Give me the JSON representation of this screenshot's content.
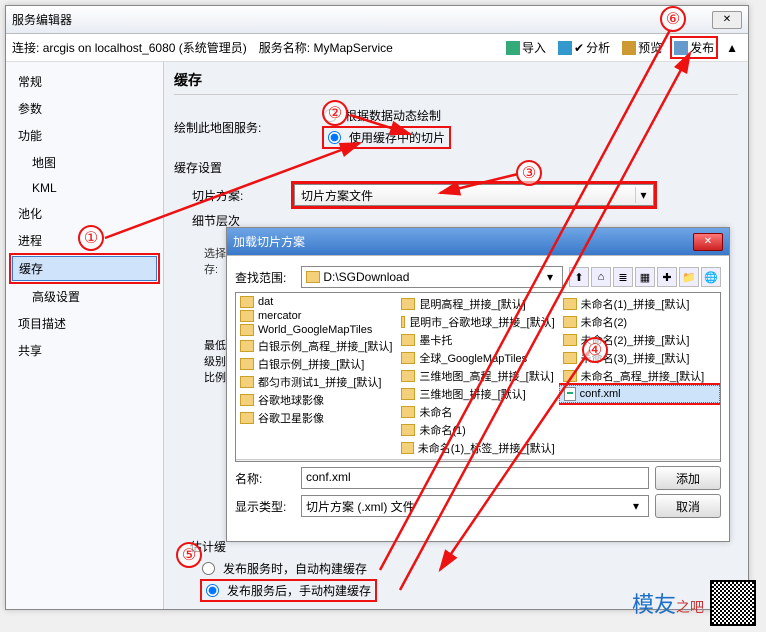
{
  "window": {
    "title": "服务编辑器",
    "close_glyph": "✕"
  },
  "conn": {
    "label": "连接:",
    "value": "arcgis on localhost_6080 (系统管理员)",
    "svc_label": "服务名称:",
    "svc_value": "MyMapService"
  },
  "toolbar": {
    "import": "导入",
    "analyze": "分析",
    "preview": "预览",
    "publish": "发布"
  },
  "sidebar": {
    "items": [
      "常规",
      "参数",
      "功能"
    ],
    "sub_items": [
      "地图",
      "KML"
    ],
    "items2": [
      "池化",
      "进程"
    ],
    "selected": "缓存",
    "items3": [
      "高级设置",
      "项目描述",
      "共享"
    ]
  },
  "content": {
    "title": "缓存",
    "draw_label": "绘制此地图服务:",
    "radio_dynamic": "根据数据动态绘制",
    "radio_tiles": "使用缓存中的切片",
    "cache_settings": "缓存设置",
    "scheme_label": "切片方案:",
    "scheme_value": "切片方案文件",
    "detail_label": "细节层次",
    "select_label": "选择\n存:",
    "min_label": "最低",
    "level_label": "级别",
    "ratio_label": "比例"
  },
  "dlg": {
    "title": "加载切片方案",
    "scope_label": "查找范围:",
    "scope_value": "D:\\SGDownload",
    "name_label": "名称:",
    "name_value": "conf.xml",
    "type_label": "显示类型:",
    "type_value": "切片方案 (.xml) 文件",
    "add_btn": "添加",
    "cancel_btn": "取消",
    "col1": [
      "dat",
      "mercator",
      "World_GoogleMapTiles",
      "白银示例_高程_拼接_[默认]",
      "白银示例_拼接_[默认]",
      "都匀市测试1_拼接_[默认]",
      "谷歌地球影像",
      "谷歌卫星影像"
    ],
    "col2": [
      "昆明高程_拼接_[默认]",
      "昆明市_谷歌地球_拼接_[默认]",
      "墨卡托",
      "全球_GoogleMapTiles",
      "三维地图_高程_拼接_[默认]",
      "三维地图_拼接_[默认]",
      "未命名",
      "未命名(1)",
      "未命名(1)_标签_拼接_[默认]"
    ],
    "col3_folders": [
      "未命名(1)_拼接_[默认]",
      "未命名(2)",
      "未命名(2)_拼接_[默认]",
      "未命名(3)_拼接_[默认]",
      "未命名_高程_拼接_[默认]"
    ],
    "col3_file": "conf.xml"
  },
  "estimate": {
    "label": "估计缓",
    "opt1": "发布服务时，自动构建缓存",
    "opt2": "发布服务后，手动构建缓存"
  },
  "annotations": {
    "a1": "①",
    "a2": "②",
    "a3": "③",
    "a4": "④",
    "a5": "⑤",
    "a6": "⑥"
  },
  "watermark": {
    "brand_main": "模友",
    "brand_sub": "之吧"
  }
}
